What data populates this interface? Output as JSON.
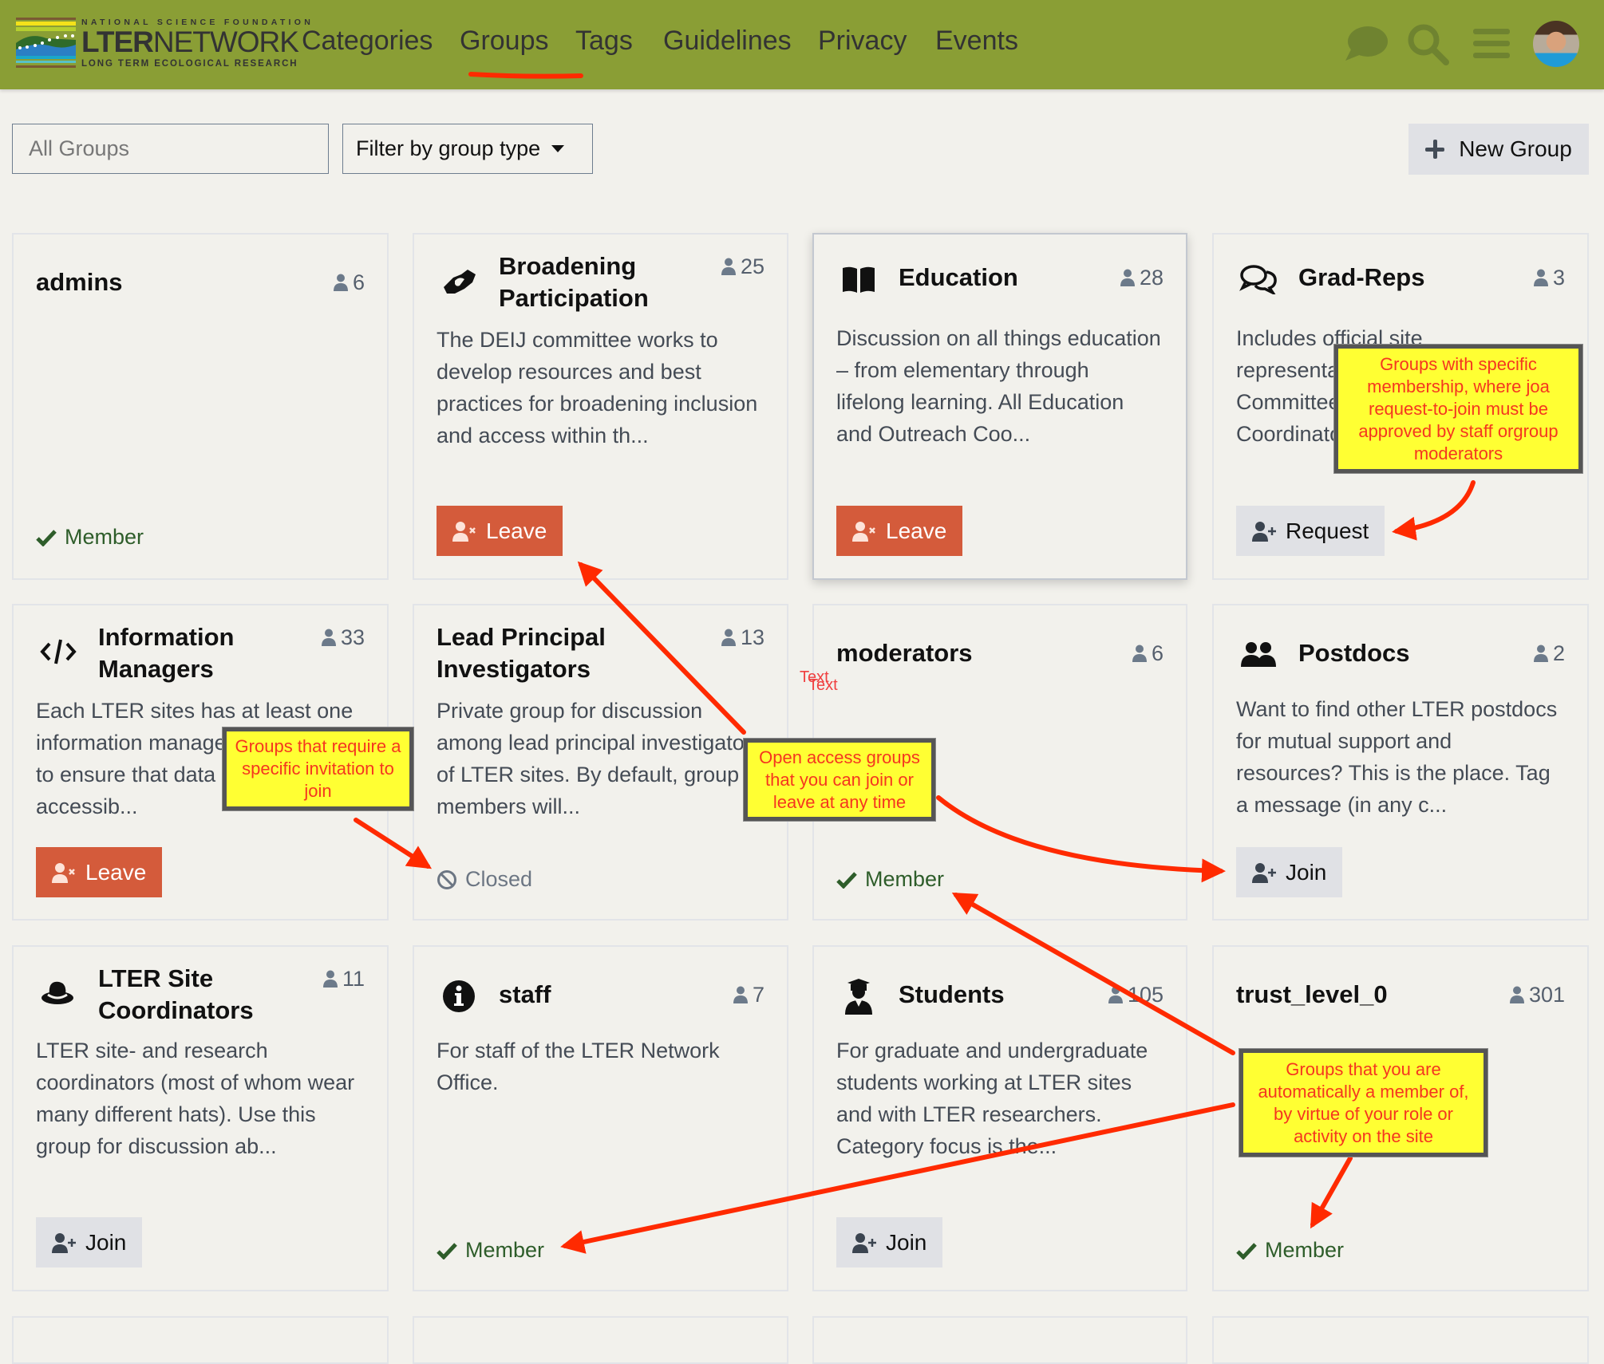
{
  "header": {
    "logo": {
      "line1": "NATIONAL SCIENCE FOUNDATION",
      "lter": "LTER",
      "network": "NETWORK",
      "line3": "LONG TERM ECOLOGICAL RESEARCH"
    },
    "nav": [
      {
        "label": "Categories"
      },
      {
        "label": "Groups",
        "active": true
      },
      {
        "label": "Tags"
      },
      {
        "label": "Guidelines"
      },
      {
        "label": "Privacy"
      },
      {
        "label": "Events"
      }
    ],
    "icons": [
      "chat-icon",
      "search-icon",
      "hamburger-menu-icon",
      "user-avatar"
    ]
  },
  "controls": {
    "search_placeholder": "All Groups",
    "search_value": "",
    "filter_label": "Filter by group type",
    "new_group_label": "New Group"
  },
  "groups": [
    {
      "name": "admins",
      "icon": "",
      "count": "6",
      "description": "",
      "status": "member",
      "status_label": "Member"
    },
    {
      "name": "Broadening Participation",
      "icon": "handshake-icon",
      "count": "25",
      "description": "The DEIJ committee works to develop resources and best practices for broadening inclusion and access within th...",
      "status": "leave",
      "status_label": "Leave"
    },
    {
      "name": "Education",
      "icon": "book-icon",
      "count": "28",
      "description": "Discussion on all things education – from elementary through lifelong learning. All Education and Outreach Coo...",
      "status": "leave",
      "status_label": "Leave"
    },
    {
      "name": "Grad-Reps",
      "icon": "comments-icon",
      "count": "3",
      "description": "Includes official site representatives to the Grad Committee and sometimes Grad Coordinators for the LTER Gr...",
      "status": "request",
      "status_label": "Request"
    },
    {
      "name": "Information Managers",
      "icon": "code-icon",
      "count": "33",
      "description": "Each LTER sites has at least one information manager who works to ensure that data is findable, accessib...",
      "status": "leave",
      "status_label": "Leave"
    },
    {
      "name": "Lead Principal Investigators",
      "icon": "",
      "count": "13",
      "description": "Private group for discussion among lead principal investigators of LTER sites. By default, group members will...",
      "status": "closed",
      "status_label": "Closed"
    },
    {
      "name": "moderators",
      "icon": "",
      "count": "6",
      "description": "",
      "status": "member",
      "status_label": "Member"
    },
    {
      "name": "Postdocs",
      "icon": "users-icon",
      "count": "2",
      "description": "Want to find other LTER postdocs for mutual support and resources? This is the place. Tag a message (in any c...",
      "status": "join",
      "status_label": "Join"
    },
    {
      "name": "LTER Site Coordinators",
      "icon": "hat-icon",
      "count": "11",
      "description": "LTER site- and research coordinators (most of whom wear many different hats). Use this group for discussion ab...",
      "status": "join",
      "status_label": "Join"
    },
    {
      "name": "staff",
      "icon": "info-circle-icon",
      "count": "7",
      "description": "For staff of the LTER Network Office.",
      "status": "member",
      "status_label": "Member"
    },
    {
      "name": "Students",
      "icon": "graduate-icon",
      "count": "105",
      "description": "For graduate and undergraduate students working at LTER sites and with LTER researchers. Category focus is the...",
      "status": "join",
      "status_label": "Join"
    },
    {
      "name": "trust_level_0",
      "icon": "",
      "count": "301",
      "description": "",
      "status": "member",
      "status_label": "Member"
    }
  ],
  "annotations": {
    "request_callout": "Groups with specific membership, where joa request-to-join must be approved by staff orgroup moderators",
    "invite_callout": "Groups that require a specific invitation to join",
    "open_callout": "Open access groups that you can join or leave at any time",
    "auto_callout": "Groups that you are automatically a member of, by virtue of your role or activity on the site",
    "stray_text_1": "Text",
    "stray_text_2": "Text"
  },
  "colors": {
    "header_bg": "#8a9e35",
    "leave_button": "#d45b3b",
    "join_button": "#e0e1e5",
    "member_green": "#2e5d2a",
    "callout_bg": "#ffff33",
    "callout_text": "#f5361f",
    "annotation_arrow": "#ff2a00"
  }
}
